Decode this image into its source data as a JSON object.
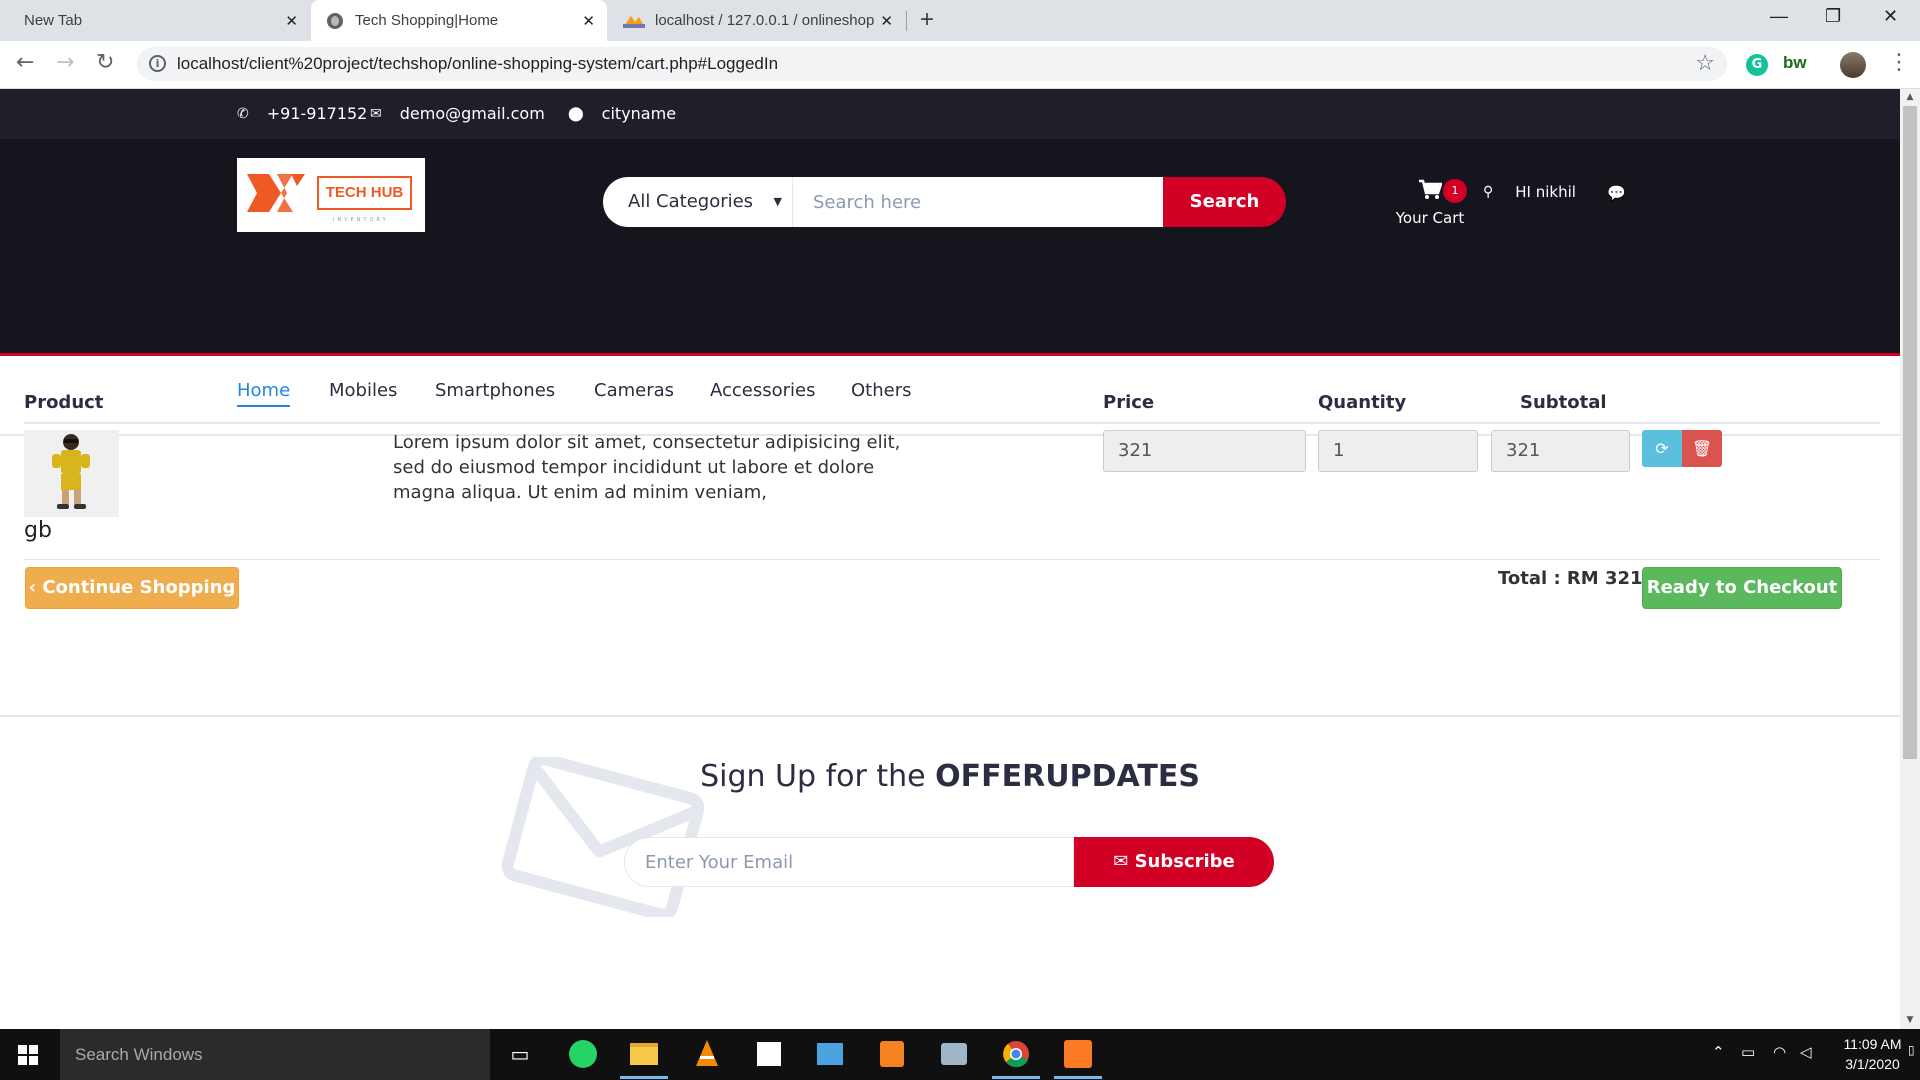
{
  "browser": {
    "tabs": [
      {
        "title": "New Tab"
      },
      {
        "title": "Tech Shopping|Home"
      },
      {
        "title": "localhost / 127.0.0.1 / onlineshop"
      }
    ],
    "url": "localhost/client%20project/techshop/online-shopping-system/cart.php#LoggedIn",
    "extensions": [
      "grammarly-icon",
      "bw-extension",
      "profile-avatar"
    ]
  },
  "top_info": {
    "phone": "+91-917152",
    "email": "demo@gmail.com",
    "location": "cityname"
  },
  "header": {
    "logo_text": "TECH HUB",
    "logo_subtext": "INVENTORY",
    "search": {
      "category": "All Categories",
      "placeholder": "Search here",
      "button": "Search"
    },
    "cart": {
      "count": "1",
      "label": "Your Cart"
    },
    "user_greeting": "HI nikhil"
  },
  "nav": {
    "items": [
      {
        "label": "Home",
        "active": true
      },
      {
        "label": "Mobiles"
      },
      {
        "label": "Smartphones"
      },
      {
        "label": "Cameras"
      },
      {
        "label": "Accessories"
      },
      {
        "label": "Others"
      }
    ]
  },
  "cart_table": {
    "headers": {
      "product": "Product",
      "price": "Price",
      "quantity": "Quantity",
      "subtotal": "Subtotal"
    },
    "rows": [
      {
        "name": "gb",
        "description": "Lorem ipsum dolor sit amet, consectetur adipisicing elit, sed do eiusmod tempor incididunt ut labore et dolore magna aliqua. Ut enim ad minim veniam,",
        "price": "321",
        "quantity": "1",
        "subtotal": "321"
      }
    ],
    "continue_button": "Continue Shopping",
    "total": "Total : RM 321",
    "checkout_button": "Ready to Checkout"
  },
  "newsletter": {
    "title_prefix": "Sign Up for the ",
    "title_bold": "OFFERUPDATES",
    "placeholder": "Enter Your Email",
    "button": "Subscribe"
  },
  "taskbar": {
    "search_placeholder": "Search Windows",
    "time": "11:09 AM",
    "date": "3/1/2020"
  },
  "colors": {
    "accent_red": "#d10024",
    "header_dark": "#15161d",
    "nav_active": "#1e88e5",
    "checkout_green": "#5cb85c",
    "continue_orange": "#f0ad4e"
  }
}
